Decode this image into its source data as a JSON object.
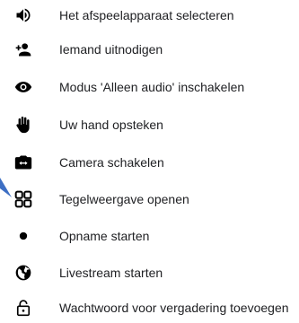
{
  "menu": {
    "items": [
      {
        "label": "Het afspeelapparaat selecteren",
        "icon": "speaker-icon"
      },
      {
        "label": "Iemand uitnodigen",
        "icon": "add-person-icon"
      },
      {
        "label": "Modus 'Alleen audio' inschakelen",
        "icon": "eye-icon"
      },
      {
        "label": "Uw hand opsteken",
        "icon": "raised-hand-icon"
      },
      {
        "label": "Camera schakelen",
        "icon": "switch-camera-icon"
      },
      {
        "label": "Tegelweergave openen",
        "icon": "tile-view-icon"
      },
      {
        "label": "Opname starten",
        "icon": "record-icon"
      },
      {
        "label": "Livestream starten",
        "icon": "livestream-icon"
      },
      {
        "label": "Wachtwoord voor vergadering toevoegen",
        "icon": "lock-icon"
      }
    ]
  },
  "colors": {
    "icon": "#000000",
    "text": "#202124",
    "pointer": "#3d6fc4",
    "background": "#ffffff"
  }
}
